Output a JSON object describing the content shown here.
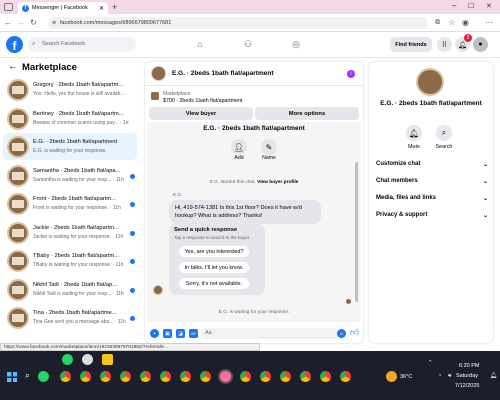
{
  "browser": {
    "tab_title": "Messenger | Facebook",
    "url": "facebook.com/messages/t/896679809677681",
    "status_url": "https://www.facebook.com/marketplace/item/1923639979781850/?referralS..."
  },
  "header": {
    "search_placeholder": "Search Facebook",
    "find_friends": "Find friends",
    "notif_count": "2"
  },
  "sidebar": {
    "title": "Marketplace",
    "items": [
      {
        "name": "Gregory · 2beds 1bath flat/apartm...",
        "sub": "You: Hello, yes the house is still availab... · 1h",
        "unread": false,
        "active": false
      },
      {
        "name": "Bertiney · 2beds 1bath flat/apartm...",
        "sub": "Beware of common scams using pay... · 1m",
        "unread": false,
        "active": false
      },
      {
        "name": "E.G. · 2beds 1bath flat/apartment",
        "sub": "E.G. is waiting for your response.",
        "unread": false,
        "active": true
      },
      {
        "name": "Samantha · 2beds 1bath flat/apa...",
        "sub": "Samantha is waiting for your resp... · 11h",
        "unread": true,
        "active": false
      },
      {
        "name": "Front · 2beds 1bath flat/apartm...",
        "sub": "Front is waiting for your response. · 11h",
        "unread": true,
        "active": false
      },
      {
        "name": "Jackie · 2beds 1bath flat/apartm...",
        "sub": "Jackie is waiting for your response. · 11h",
        "unread": true,
        "active": false
      },
      {
        "name": "TBaby · 2beds 1bath flat/apartm...",
        "sub": "TBaby is waiting for your response. · 11h",
        "unread": true,
        "active": false
      },
      {
        "name": "Nikhil Tadi · 2beds 1bath flat/ap...",
        "sub": "Nikhil Tadi is waiting for your resp... · 11h",
        "unread": true,
        "active": false
      },
      {
        "name": "Tina · 2beds 1bath flat/apartme...",
        "sub": "Tina Gee sent you a message abo... · 11h",
        "unread": true,
        "active": false
      }
    ]
  },
  "chat": {
    "title": "E.G. · 2beds 1bath flat/apartment",
    "listing_label": "Marketplace",
    "listing_price": "$700 · 2beds 1bath flat/apartment",
    "view_buyer": "View buyer",
    "more_options": "More options",
    "inner_title": "E.G. · 2beds 1bath flat/apartment",
    "add_label": "Add",
    "name_label": "Name",
    "started_text": "E.G. started this chat.",
    "view_profile": "View buyer profile",
    "sender": "E.G.",
    "message": "Hi, 419-574-1381 Is this 1st floor? Does it have w/d hookup? What is address? Thanks!",
    "quick_title": "Send a quick response",
    "quick_sub": "Tap a response to send it to the buyer.",
    "quick": [
      "Yes, are you interested?",
      "In talks. I'll let you know.",
      "Sorry, it's not available."
    ],
    "waiting": "E.G. is waiting for your response.",
    "composer_placeholder": "Aa"
  },
  "panel": {
    "name": "E.G. · 2beds 1bath flat/apartment",
    "mute": "Mute",
    "search": "Search",
    "rows": [
      "Customize chat",
      "Chat members",
      "Media, files and links",
      "Privacy & support"
    ]
  },
  "taskbar": {
    "weather": "36°C",
    "time": "6:20 PM",
    "day": "Saturday",
    "date": "7/12/2025"
  },
  "colors": {
    "accent": "#1877f2",
    "active_item": "#e7f3ff",
    "taskbar": "#1c1e2c"
  }
}
